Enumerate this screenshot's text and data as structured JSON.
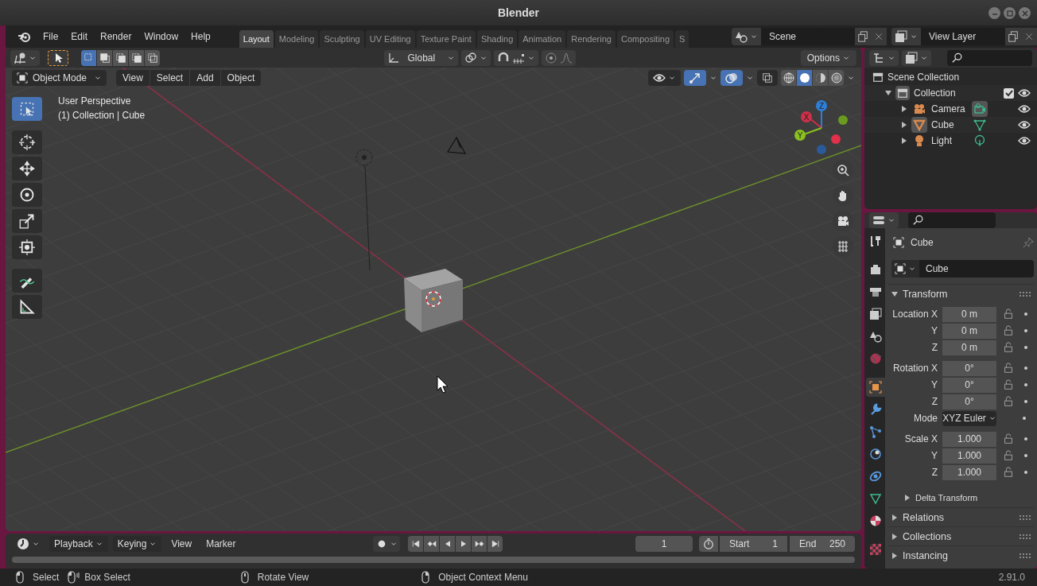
{
  "window": {
    "title": "Blender"
  },
  "menubar": {
    "items": [
      "File",
      "Edit",
      "Render",
      "Window",
      "Help"
    ]
  },
  "workspaces": [
    {
      "label": "Layout",
      "selected": true
    },
    {
      "label": "Modeling",
      "selected": false
    },
    {
      "label": "Sculpting",
      "selected": false
    },
    {
      "label": "UV Editing",
      "selected": false
    },
    {
      "label": "Texture Paint",
      "selected": false
    },
    {
      "label": "Shading",
      "selected": false
    },
    {
      "label": "Animation",
      "selected": false
    },
    {
      "label": "Rendering",
      "selected": false
    },
    {
      "label": "Compositing",
      "selected": false
    },
    {
      "label": "S",
      "selected": false
    }
  ],
  "scene": {
    "value": "Scene"
  },
  "view_layer": {
    "value": "View Layer"
  },
  "viewport": {
    "select_modes": [
      {
        "selected": true
      },
      {
        "selected": false
      },
      {
        "selected": false
      },
      {
        "selected": false
      },
      {
        "selected": false
      }
    ],
    "orientation": "Global",
    "options": "Options",
    "mode": "Object Mode",
    "menus": [
      "View",
      "Select",
      "Add",
      "Object"
    ],
    "gizmos_on": true,
    "overlays_on": true,
    "shading": [
      {
        "selected": false
      },
      {
        "selected": true
      },
      {
        "selected": false
      },
      {
        "selected": false
      }
    ],
    "info": [
      "User Perspective",
      "(1) Collection | Cube"
    ],
    "tools": [
      {
        "kind": "select",
        "selected": true
      },
      {
        "kind": "cursor",
        "selected": false
      },
      {
        "kind": "move",
        "selected": false
      },
      {
        "kind": "rotate",
        "selected": false
      },
      {
        "kind": "scale",
        "selected": false
      },
      {
        "kind": "transform",
        "selected": false
      },
      {
        "kind": "annotate",
        "selected": false
      },
      {
        "kind": "measure",
        "selected": false
      }
    ],
    "axes": [
      "X",
      "Y",
      "Z"
    ]
  },
  "outliner": {
    "root": "Scene Collection",
    "collections": [
      {
        "label": "Collection",
        "expanded": true,
        "checked": true,
        "children": [
          {
            "label": "Camera",
            "kind": "camera",
            "expanded": false,
            "active": false,
            "data_active": true
          },
          {
            "label": "Cube",
            "kind": "mesh",
            "expanded": false,
            "active": true,
            "data_active": false
          },
          {
            "label": "Light",
            "kind": "light",
            "expanded": false,
            "active": false,
            "data_active": false
          }
        ]
      }
    ]
  },
  "properties": {
    "tabs": [
      {
        "kind": "tool",
        "selected": false
      },
      {
        "kind": "render",
        "selected": false
      },
      {
        "kind": "output",
        "selected": false
      },
      {
        "kind": "view_layer",
        "selected": false
      },
      {
        "kind": "scene",
        "selected": false
      },
      {
        "kind": "world",
        "selected": false
      },
      {
        "kind": "object",
        "selected": true
      },
      {
        "kind": "modifiers",
        "selected": false
      },
      {
        "kind": "particles",
        "selected": false
      },
      {
        "kind": "physics",
        "selected": false
      },
      {
        "kind": "constraints",
        "selected": false
      },
      {
        "kind": "data",
        "selected": false
      },
      {
        "kind": "material",
        "selected": false
      },
      {
        "kind": "texture",
        "selected": false
      }
    ],
    "object": "Cube",
    "data_block": "Cube",
    "panels": [
      {
        "kind": "panel",
        "label": "Transform",
        "expanded": true,
        "groups": [
          [
            {
              "kind": "number",
              "label": "Location X",
              "value": "0 m"
            },
            {
              "kind": "number",
              "label": "Y",
              "value": "0 m"
            },
            {
              "kind": "number",
              "label": "Z",
              "value": "0 m"
            }
          ],
          [
            {
              "kind": "number",
              "label": "Rotation X",
              "value": "0°"
            },
            {
              "kind": "number",
              "label": "Y",
              "value": "0°"
            },
            {
              "kind": "number",
              "label": "Z",
              "value": "0°"
            },
            {
              "kind": "dropdown",
              "label": "Mode",
              "value": "XYZ Euler"
            }
          ],
          [
            {
              "kind": "number",
              "label": "Scale X",
              "value": "1.000"
            },
            {
              "kind": "number",
              "label": "Y",
              "value": "1.000"
            },
            {
              "kind": "number",
              "label": "Z",
              "value": "1.000"
            }
          ]
        ]
      },
      {
        "kind": "subpanel",
        "label": "Delta Transform",
        "expanded": false
      },
      {
        "kind": "panel",
        "label": "Relations",
        "expanded": false
      },
      {
        "kind": "panel",
        "label": "Collections",
        "expanded": false
      },
      {
        "kind": "panel",
        "label": "Instancing",
        "expanded": false
      }
    ]
  },
  "timeline": {
    "menus": [
      {
        "kind": "dropdown",
        "label": "Playback"
      },
      {
        "kind": "dropdown",
        "label": "Keying"
      },
      {
        "kind": "menu",
        "label": "View"
      },
      {
        "kind": "menu",
        "label": "Marker"
      }
    ],
    "current_frame": "1",
    "start_label": "Start",
    "start": "1",
    "end_label": "End",
    "end": "250"
  },
  "status": {
    "items": [
      {
        "kind": "left",
        "label": "Select"
      },
      {
        "kind": "drag",
        "label": "Box Select"
      },
      {
        "kind": "middle",
        "label": "Rotate View"
      },
      {
        "kind": "right",
        "label": "Object Context Menu"
      }
    ],
    "version": "2.91.0"
  }
}
